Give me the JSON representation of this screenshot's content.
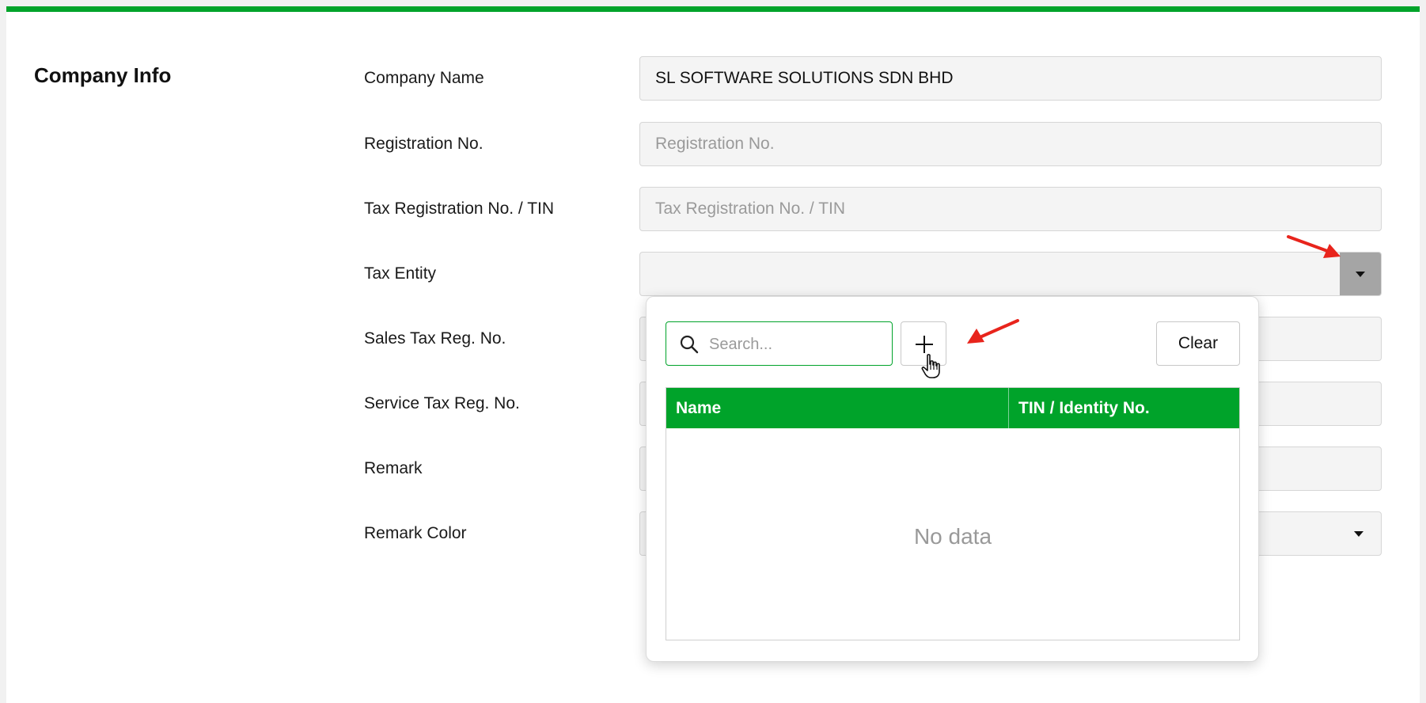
{
  "section": {
    "title": "Company Info"
  },
  "fields": {
    "company_name": {
      "label": "Company Name",
      "value": "SL SOFTWARE SOLUTIONS SDN BHD",
      "placeholder": ""
    },
    "registration_no": {
      "label": "Registration No.",
      "value": "",
      "placeholder": "Registration No."
    },
    "tax_registration_no": {
      "label": "Tax Registration No. / TIN",
      "value": "",
      "placeholder": "Tax Registration No. / TIN"
    },
    "tax_entity": {
      "label": "Tax Entity",
      "value": ""
    },
    "sales_tax_reg_no": {
      "label": "Sales Tax Reg. No."
    },
    "service_tax_reg_no": {
      "label": "Service Tax Reg. No."
    },
    "remark": {
      "label": "Remark"
    },
    "remark_color": {
      "label": "Remark Color"
    }
  },
  "popup": {
    "search_placeholder": "Search...",
    "clear_label": "Clear",
    "table": {
      "columns": [
        "Name",
        "TIN / Identity No."
      ],
      "rows": [],
      "empty_text": "No data"
    }
  },
  "icons": {
    "search": "search-icon",
    "add": "plus-icon",
    "cursor": "hand-pointer-icon",
    "dropdown": "caret-down-icon",
    "annotation": "red-arrow-icon"
  },
  "colors": {
    "accent": "#00a32a",
    "annotation": "#e8241c",
    "dropdown_button": "#a5a5a5"
  }
}
